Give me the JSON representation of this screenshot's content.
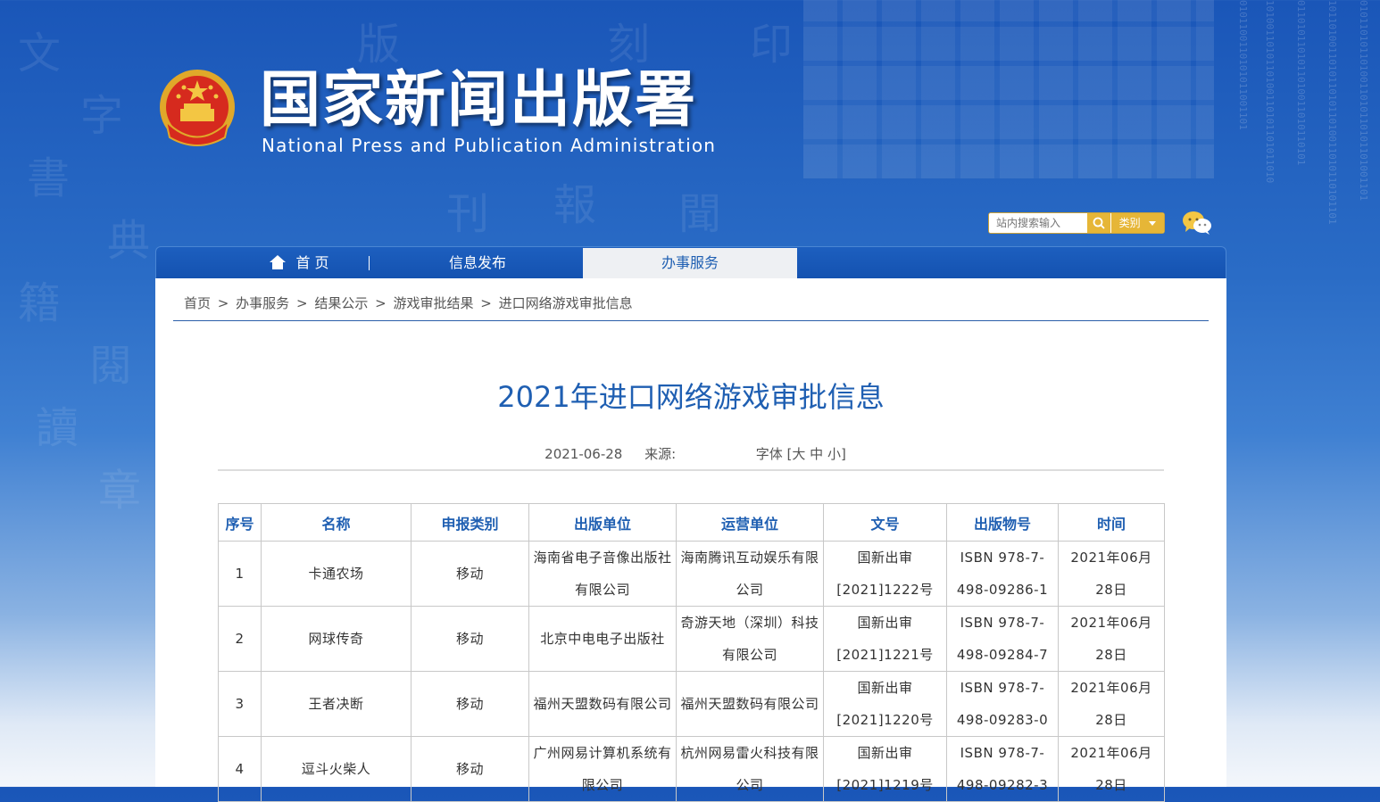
{
  "header": {
    "title": "国家新闻出版署",
    "subtitle": "National  Press and Publication Administration",
    "search_placeholder": "站内搜索输入",
    "category_label": "类别"
  },
  "nav": {
    "home": "首 页",
    "info": "信息发布",
    "service": "办事服务"
  },
  "breadcrumb": {
    "items": [
      "首页",
      "办事服务",
      "结果公示",
      "游戏审批结果",
      "进口网络游戏审批信息"
    ],
    "sep": ">"
  },
  "article": {
    "title": "2021年进口网络游戏审批信息",
    "date": "2021-06-28",
    "source_label": "来源:",
    "font_label": "字体 [",
    "font_large": "大",
    "font_medium": "中",
    "font_small": "小",
    "font_close": "]"
  },
  "table": {
    "headers": [
      "序号",
      "名称",
      "申报类别",
      "出版单位",
      "运营单位",
      "文号",
      "出版物号",
      "时间"
    ],
    "rows": [
      [
        "1",
        "卡通农场",
        "移动",
        "海南省电子音像出版社有限公司",
        "海南腾讯互动娱乐有限公司",
        "国新出审[2021]1222号",
        "ISBN 978-7-498-09286-1",
        "2021年06月28日"
      ],
      [
        "2",
        "网球传奇",
        "移动",
        "北京中电电子出版社",
        "奇游天地（深圳）科技有限公司",
        "国新出审[2021]1221号",
        "ISBN 978-7-498-09284-7",
        "2021年06月28日"
      ],
      [
        "3",
        "王者决断",
        "移动",
        "福州天盟数码有限公司",
        "福州天盟数码有限公司",
        "国新出审[2021]1220号",
        "ISBN 978-7-498-09283-0",
        "2021年06月28日"
      ],
      [
        "4",
        "逗斗火柴人",
        "移动",
        "广州网易计算机系统有限公司",
        "杭州网易雷火科技有限公司",
        "国新出审[2021]1219号",
        "ISBN 978-7-498-09282-3",
        "2021年06月28日"
      ]
    ]
  },
  "colors": {
    "accent": "#1f5fb2",
    "nav_bg": "#1452b0",
    "search_btn": "#e6b637"
  },
  "icons": [
    "national-emblem-icon",
    "search-icon",
    "dropdown-arrow-icon",
    "wechat-icon",
    "home-icon"
  ]
}
